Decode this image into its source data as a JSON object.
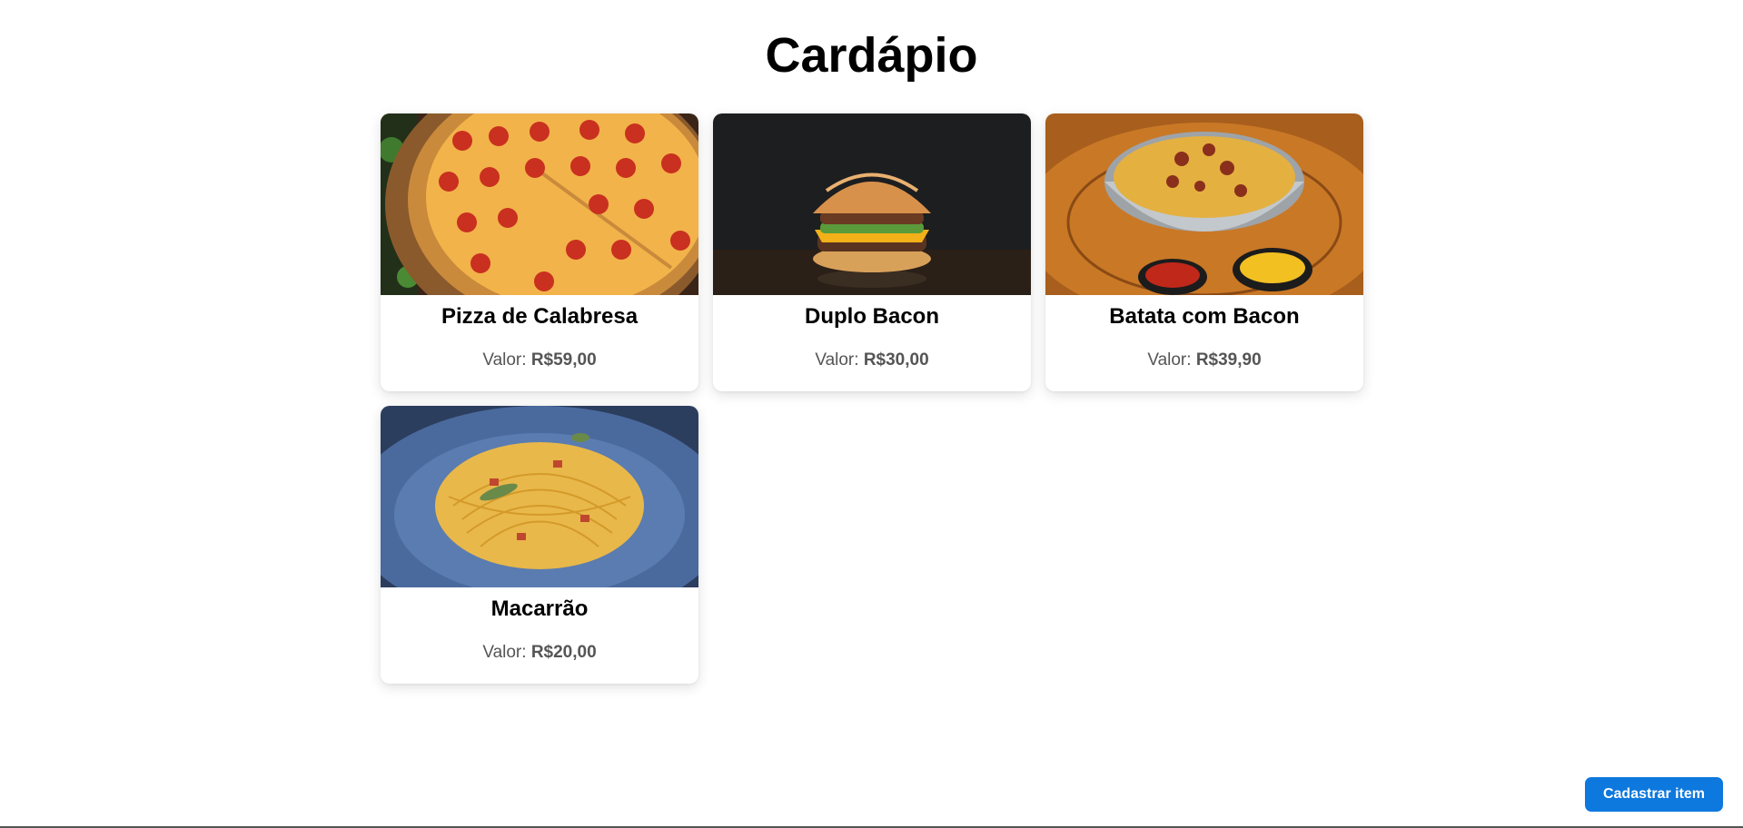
{
  "page": {
    "title": "Cardápio"
  },
  "price_prefix": "Valor:",
  "items": [
    {
      "name": "Pizza de Calabresa",
      "price": "R$59,00",
      "image": "pizza-image"
    },
    {
      "name": "Duplo Bacon",
      "price": "R$30,00",
      "image": "burger-image"
    },
    {
      "name": "Batata com Bacon",
      "price": "R$39,90",
      "image": "fries-image"
    },
    {
      "name": "Macarrão",
      "price": "R$20,00",
      "image": "pasta-image"
    }
  ],
  "actions": {
    "add_item_label": "Cadastrar item"
  },
  "colors": {
    "accent": "#0d78dd",
    "price_text": "#555555"
  }
}
